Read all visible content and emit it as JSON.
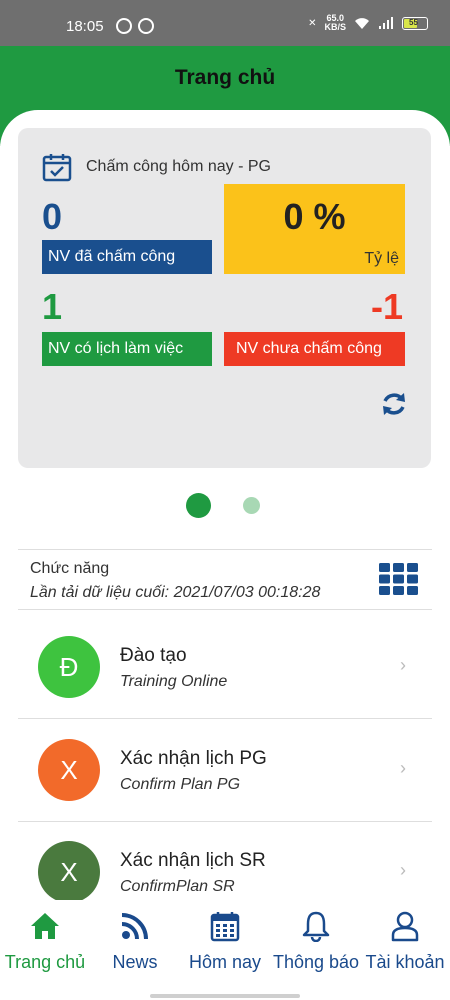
{
  "status_bar": {
    "time": "18:05",
    "net_speed_value": "65.0",
    "net_speed_unit": "KB/S",
    "battery": "55"
  },
  "header": {
    "title": "Trang chủ"
  },
  "attendance_card": {
    "heading": "Chấm công hôm nay - PG",
    "checked_in_count": "0",
    "checked_in_label": "NV đã chấm công",
    "rate_value": "0 %",
    "rate_label": "Tỷ lệ",
    "scheduled_count": "1",
    "scheduled_label": "NV có lịch làm việc",
    "not_checked_count": "-1",
    "not_checked_label": "NV chưa chấm công"
  },
  "pager": {
    "active_index": 0,
    "count": 2
  },
  "functions": {
    "title": "Chức năng",
    "last_load": "Lần tải dữ liệu cuối: 2021/07/03 00:18:28",
    "items": [
      {
        "letter": "Đ",
        "title": "Đào tạo",
        "subtitle": "Training Online",
        "color": "#3ec33f"
      },
      {
        "letter": "X",
        "title": "Xác nhận lịch PG",
        "subtitle": "Confirm Plan PG",
        "color": "#f26a2a"
      },
      {
        "letter": "X",
        "title": "Xác nhận lịch SR",
        "subtitle": "ConfirmPlan SR",
        "color": "#4a7a3e"
      }
    ]
  },
  "bottom_nav": [
    {
      "label": "Trang chủ",
      "icon": "home-icon",
      "active": true
    },
    {
      "label": "News",
      "icon": "rss-icon",
      "active": false
    },
    {
      "label": "Hôm nay",
      "icon": "calendar-icon",
      "active": false
    },
    {
      "label": "Thông báo",
      "icon": "bell-icon",
      "active": false
    },
    {
      "label": "Tài khoản",
      "icon": "user-icon",
      "active": false
    }
  ],
  "colors": {
    "primary_green": "#1f9a41",
    "nav_blue": "#1a4a8c",
    "checked_in_box": "#1a4f8e",
    "rate_box": "#fbc21a",
    "scheduled_box": "#1f9a41",
    "not_checked_box": "#ee3a24"
  }
}
